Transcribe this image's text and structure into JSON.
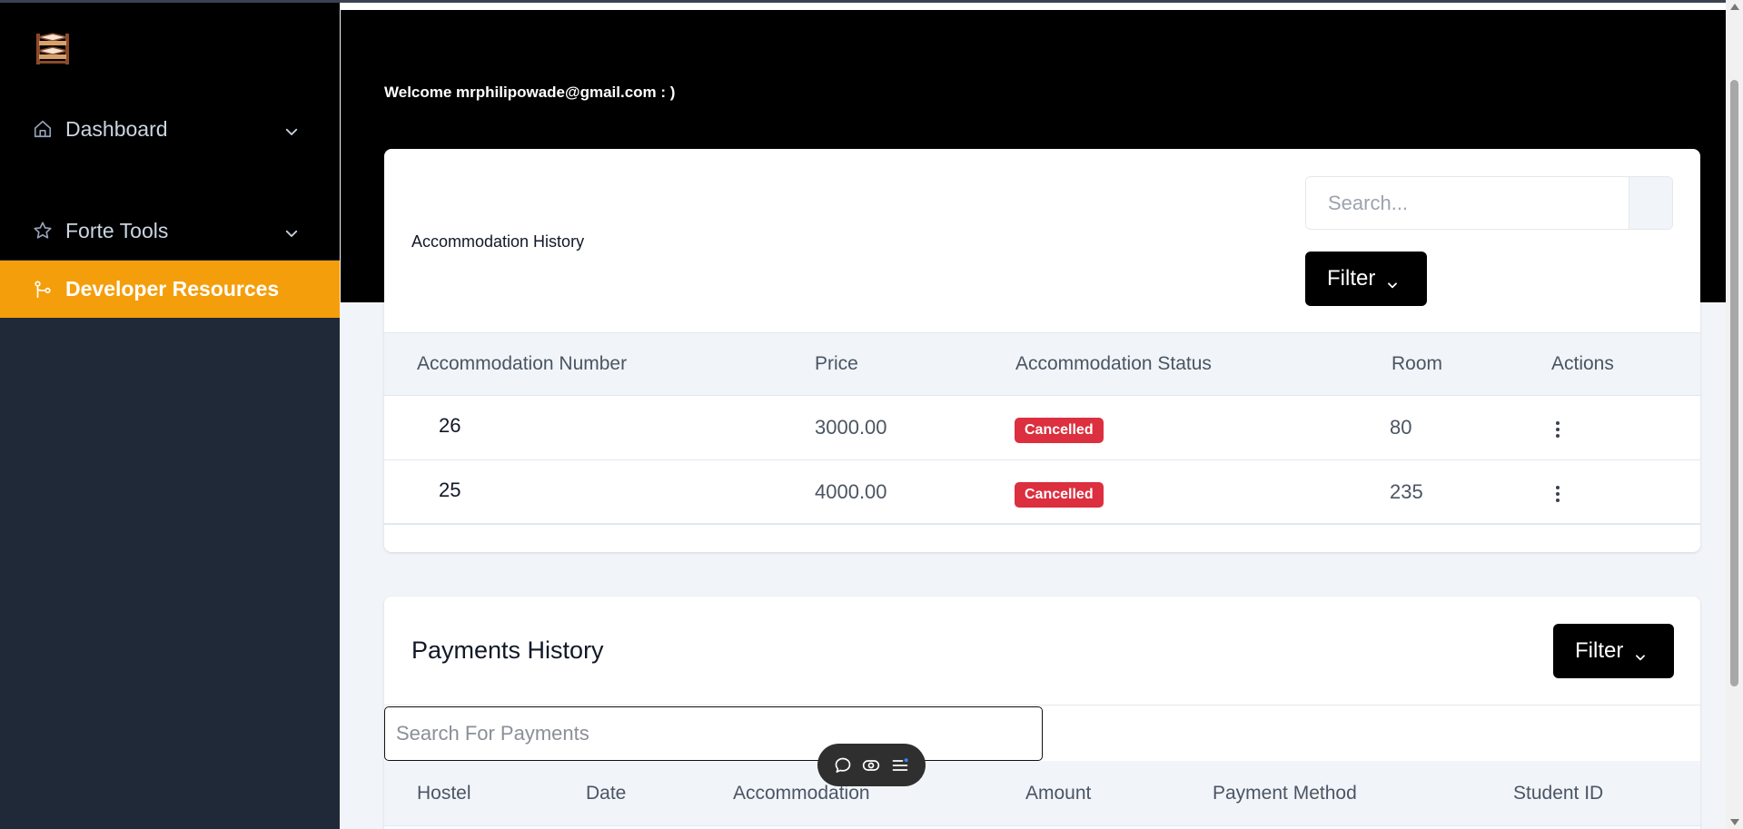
{
  "sidebar": {
    "logo": "bunk-bed-icon",
    "items": [
      {
        "label": "Dashboard",
        "icon": "home-icon",
        "expandable": true
      },
      {
        "label": "Forte Tools",
        "icon": "star-icon",
        "expandable": true
      },
      {
        "label": "Developer Resources",
        "icon": "git-branch-icon",
        "active": true
      }
    ],
    "active_color": "#f59e0b"
  },
  "header": {
    "welcome": "Welcome mrphilipowade@gmail.com : )"
  },
  "accommodation": {
    "title": "Accommodation History",
    "search_placeholder": "Search...",
    "filter_label": "Filter",
    "columns": [
      "Accommodation Number",
      "Price",
      "Accommodation Status",
      "Room",
      "Actions"
    ],
    "rows": [
      {
        "number": "26",
        "price": "3000.00",
        "status": "Cancelled",
        "room": "80"
      },
      {
        "number": "25",
        "price": "4000.00",
        "status": "Cancelled",
        "room": "235"
      }
    ],
    "status_color": "#dc2f3f"
  },
  "payments": {
    "title": "Payments History",
    "filter_label": "Filter",
    "search_placeholder": "Search For Payments",
    "columns": [
      "Hostel",
      "Date",
      "Accommodation",
      "Amount",
      "Payment Method",
      "Student ID"
    ]
  },
  "floating_toolbar": {
    "icons": [
      "chat-bubble-icon",
      "eye-toggle-icon",
      "menu-list-icon"
    ]
  }
}
